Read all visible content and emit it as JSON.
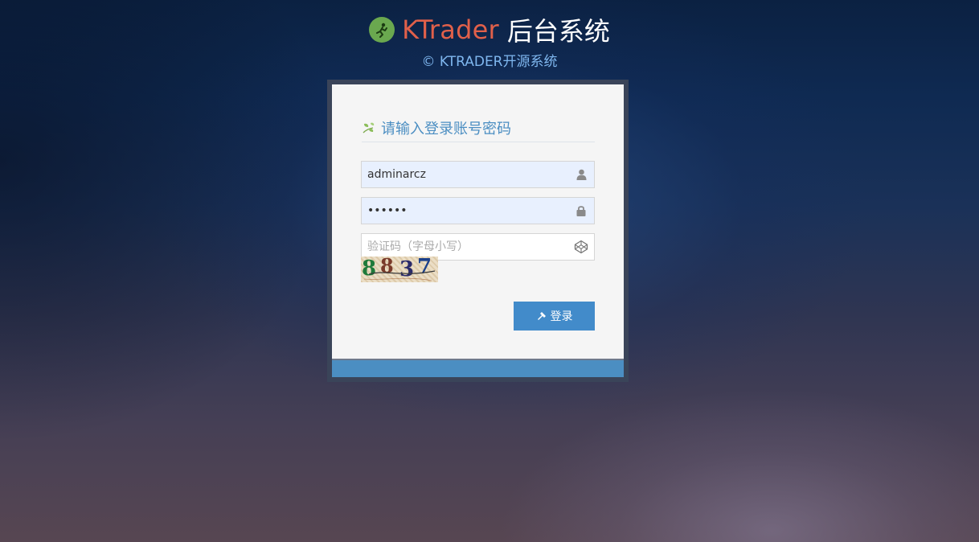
{
  "header": {
    "brand": "KTrader",
    "title_rest": "后台系统",
    "subtitle": "© KTRADER开源系统"
  },
  "login": {
    "heading": "请输入登录账号密码",
    "username": {
      "value": "adminarcz",
      "icon": "user-icon"
    },
    "password": {
      "value": "123456",
      "icon": "lock-icon"
    },
    "captcha_field": {
      "placeholder": "验证码（字母小写）",
      "icon": "codepen-icon"
    },
    "captcha_image": {
      "text": "8837"
    },
    "submit_label": "登录",
    "submit_icon": "key-icon"
  },
  "colors": {
    "brand": "#e0604a",
    "subtitle": "#7fb7ef",
    "primary": "#428bca",
    "logo_bg": "#6aa84f"
  }
}
